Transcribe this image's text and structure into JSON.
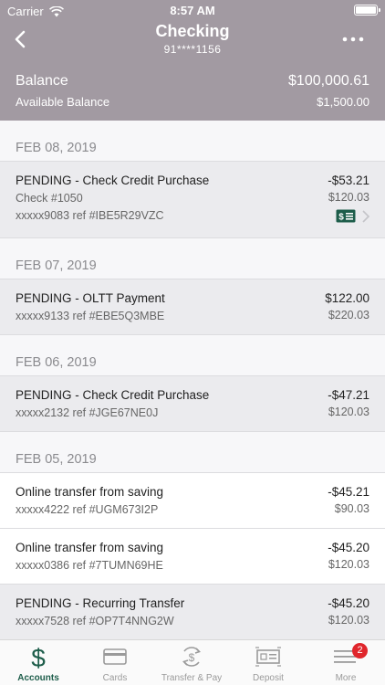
{
  "status_bar": {
    "carrier": "Carrier",
    "time": "8:57 AM"
  },
  "header": {
    "title": "Checking",
    "account_number": "91****1156",
    "balance_label": "Balance",
    "balance_value": "$100,000.61",
    "available_label": "Available Balance",
    "available_value": "$1,500.00"
  },
  "groups": [
    {
      "date": "FEB 08, 2019",
      "transactions": [
        {
          "status": "pending",
          "description": "PENDING - Check Credit Purchase",
          "lines": [
            "Check #1050",
            "xxxxx9083 ref #IBE5R29VZC"
          ],
          "amount": "-$53.21",
          "balance": "$120.03",
          "has_check_image": true
        }
      ]
    },
    {
      "date": "FEB 07, 2019",
      "transactions": [
        {
          "status": "pending",
          "description": "PENDING - OLTT Payment",
          "lines": [
            "xxxxx9133 ref #EBE5Q3MBE"
          ],
          "amount": "$122.00",
          "balance": "$220.03"
        }
      ]
    },
    {
      "date": "FEB 06, 2019",
      "transactions": [
        {
          "status": "pending",
          "description": "PENDING - Check Credit Purchase",
          "lines": [
            "xxxxx2132 ref #JGE67NE0J"
          ],
          "amount": "-$47.21",
          "balance": "$120.03"
        }
      ]
    },
    {
      "date": "FEB 05, 2019",
      "transactions": [
        {
          "status": "posted",
          "description": "Online transfer from saving",
          "lines": [
            "xxxxx4222 ref #UGM673I2P"
          ],
          "amount": "-$45.21",
          "balance": "$90.03"
        },
        {
          "status": "posted",
          "description": "Online transfer from saving",
          "lines": [
            "xxxxx0386 ref #7TUMN69HE"
          ],
          "amount": "-$45.20",
          "balance": "$120.03"
        },
        {
          "status": "pending",
          "description": "PENDING - Recurring Transfer",
          "lines": [
            "xxxxx7528 ref #OP7T4NNG2W"
          ],
          "amount": "-$45.20",
          "balance": "$120.03"
        }
      ]
    }
  ],
  "tabs": [
    {
      "label": "Accounts",
      "icon": "dollar-icon",
      "active": true
    },
    {
      "label": "Cards",
      "icon": "card-icon"
    },
    {
      "label": "Transfer & Pay",
      "icon": "transfer-icon"
    },
    {
      "label": "Deposit",
      "icon": "deposit-icon"
    },
    {
      "label": "More",
      "icon": "menu-icon",
      "badge": "2"
    }
  ],
  "colors": {
    "header_bg": "#a29aa2",
    "accent": "#1d5d4a",
    "badge": "#e0262c"
  }
}
